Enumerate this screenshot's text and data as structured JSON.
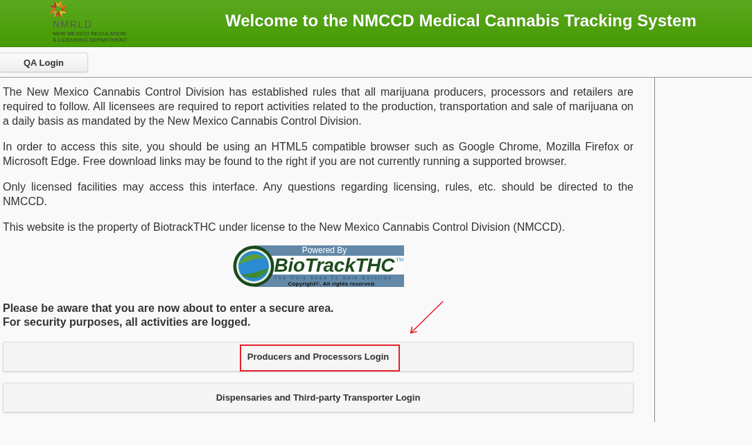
{
  "header": {
    "logo": {
      "wordmark": "NMRLD",
      "department": "NEW MEXICO REGULATION & LICENSING DEPARTMENT"
    },
    "title": "Welcome to the NMCCD Medical Cannabis Tracking System"
  },
  "toolbar": {
    "buttons": [
      "QA Login"
    ]
  },
  "content": {
    "paragraphs": [
      "The New Mexico Cannabis Control Division has established rules that all marijuana producers, processors and retailers are required to follow. All licensees are required to report activities related to the production, transportation and sale of marijuana on a daily basis as mandated by the New Mexico Cannabis Control Division.",
      "In order to access this site, you should be using an HTML5 compatible browser such as Google Chrome, Mozilla Firefox or Microsoft Edge. Free download links may be found to the right if you are not currently running a supported browser.",
      "Only licensed facilities may access this interface. Any questions regarding licensing, rules, etc. should be directed to the NMCCD.",
      "This website is the property of BiotrackTHC under license to the New Mexico Cannabis Control Division (NMCCD)."
    ],
    "powered_by_logo": {
      "caption": "Powered By",
      "brand": "BioTrackTHC",
      "trademark": "TM",
      "tagline": "The Only Seed To Sale Solution",
      "copyright": "Copyright©.  All rights reserved."
    },
    "notice": [
      "Please be aware that you are now about to enter a secure area.",
      "For security purposes, all activities are logged."
    ],
    "login_buttons": [
      {
        "label": "Producers and Processors Login",
        "highlighted": true
      },
      {
        "label": "Dispensaries and Third-party Transporter Login",
        "highlighted": false
      }
    ]
  }
}
